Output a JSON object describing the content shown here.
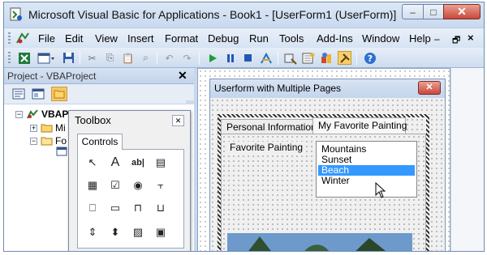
{
  "window": {
    "title": "Microsoft Visual Basic for Applications - Book1 - [UserForm1 (UserForm)]",
    "caption_buttons": {
      "minimize": "–",
      "maximize": "□",
      "close": "✕"
    }
  },
  "menubar": {
    "items": [
      "File",
      "Edit",
      "View",
      "Insert",
      "Format",
      "Debug",
      "Run",
      "Tools",
      "Add-Ins",
      "Window",
      "Help"
    ],
    "mdi_controls": {
      "minimize": "–",
      "restore": "🗗",
      "close": "×"
    }
  },
  "toolbar": {
    "icons": [
      "excel-icon",
      "insert-userform-icon",
      "save-icon",
      "cut-icon",
      "copy-icon",
      "paste-icon",
      "find-icon",
      "undo-icon",
      "redo-icon",
      "run-icon",
      "break-icon",
      "reset-icon",
      "design-mode-icon",
      "project-explorer-icon",
      "properties-icon",
      "object-browser-icon",
      "toolbox-icon",
      "help-icon"
    ]
  },
  "project_pane": {
    "title": "Project - VBAProject",
    "close": "✕",
    "tree": [
      {
        "label": "VBAP",
        "expander": "−"
      },
      {
        "label": "Mi",
        "expander": "+"
      },
      {
        "label": "Fo",
        "expander": "−"
      }
    ]
  },
  "toolbox": {
    "title": "Toolbox",
    "close": "✕",
    "tab": "Controls",
    "tools": [
      {
        "name": "select-objects-icon",
        "glyph": "↖"
      },
      {
        "name": "label-icon",
        "glyph": "A"
      },
      {
        "name": "textbox-icon",
        "glyph": "ab|"
      },
      {
        "name": "combobox-icon",
        "glyph": "▤"
      },
      {
        "name": "listbox-icon",
        "glyph": "▦"
      },
      {
        "name": "checkbox-icon",
        "glyph": "☑"
      },
      {
        "name": "optionbutton-icon",
        "glyph": "◉"
      },
      {
        "name": "togglebutton-icon",
        "glyph": "⫟"
      },
      {
        "name": "frame-icon",
        "glyph": "⎕"
      },
      {
        "name": "commandbutton-icon",
        "glyph": "▭"
      },
      {
        "name": "tabstrip-icon",
        "glyph": "⊓"
      },
      {
        "name": "multipage-icon",
        "glyph": "⊔"
      },
      {
        "name": "scrollbar-icon",
        "glyph": "⇕"
      },
      {
        "name": "spinbutton-icon",
        "glyph": "⬍"
      },
      {
        "name": "image-icon",
        "glyph": "▨"
      },
      {
        "name": "refedit-icon",
        "glyph": "▣"
      }
    ]
  },
  "userform": {
    "title": "Userform with Multiple Pages",
    "close": "✕",
    "tabs": [
      "Personal Information",
      "My Favorite Painting"
    ],
    "active_tab": "My Favorite Painting",
    "label": "Favorite Painting",
    "listbox": {
      "items": [
        "Mountains",
        "Sunset",
        "Beach",
        "Winter"
      ],
      "selected": "Beach"
    }
  },
  "colors": {
    "selection": "#3399ff",
    "close_button": "#c9483a",
    "window_frame": "#c7d8ee"
  }
}
